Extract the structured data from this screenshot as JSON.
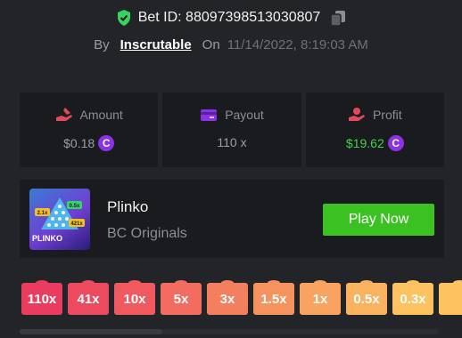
{
  "header": {
    "bet_id_text": "Bet ID: 88097398513030807",
    "by_label": "By",
    "username": "Inscrutable",
    "on_label": "On",
    "date": "11/14/2022, 8:19:03 AM"
  },
  "stats": [
    {
      "label": "Amount",
      "value": "$0.18",
      "icon": "hand-coin-icon",
      "icon_color": "#e24a5c",
      "coin": true,
      "value_color": "#9c9ea5"
    },
    {
      "label": "Payout",
      "value": "110 x",
      "icon": "card-icon",
      "icon_color": "#8b31e8",
      "coin": false,
      "value_color": "#9c9ea5"
    },
    {
      "label": "Profit",
      "value": "$19.62",
      "icon": "hand-profit-icon",
      "icon_color": "#e24a5c",
      "coin": true,
      "value_color": "#44d24a"
    }
  ],
  "coin_symbol": "C",
  "game": {
    "title": "Plinko",
    "provider": "BC Originals",
    "play_label": "Play Now",
    "thumb_text": "PLINKO",
    "thumb_badges": [
      "2.1x",
      "0.5x",
      "421x"
    ]
  },
  "multipliers": [
    {
      "label": "110x",
      "color": "#ea3c5e"
    },
    {
      "label": "41x",
      "color": "#ec4a5e"
    },
    {
      "label": "10x",
      "color": "#f05a5f"
    },
    {
      "label": "5x",
      "color": "#f26c5f"
    },
    {
      "label": "3x",
      "color": "#f47f5e"
    },
    {
      "label": "1.5x",
      "color": "#f6925e"
    },
    {
      "label": "1x",
      "color": "#f8a35f"
    },
    {
      "label": "0.5x",
      "color": "#f9b25f"
    },
    {
      "label": "0.3x",
      "color": "#fbc25f"
    },
    {
      "label": "",
      "color": "#fbc25f"
    }
  ],
  "colors": {
    "accent_green": "#3bc121",
    "shield_green": "#3ad25e",
    "background": "#232428",
    "card_bg": "#1a1b1f"
  }
}
